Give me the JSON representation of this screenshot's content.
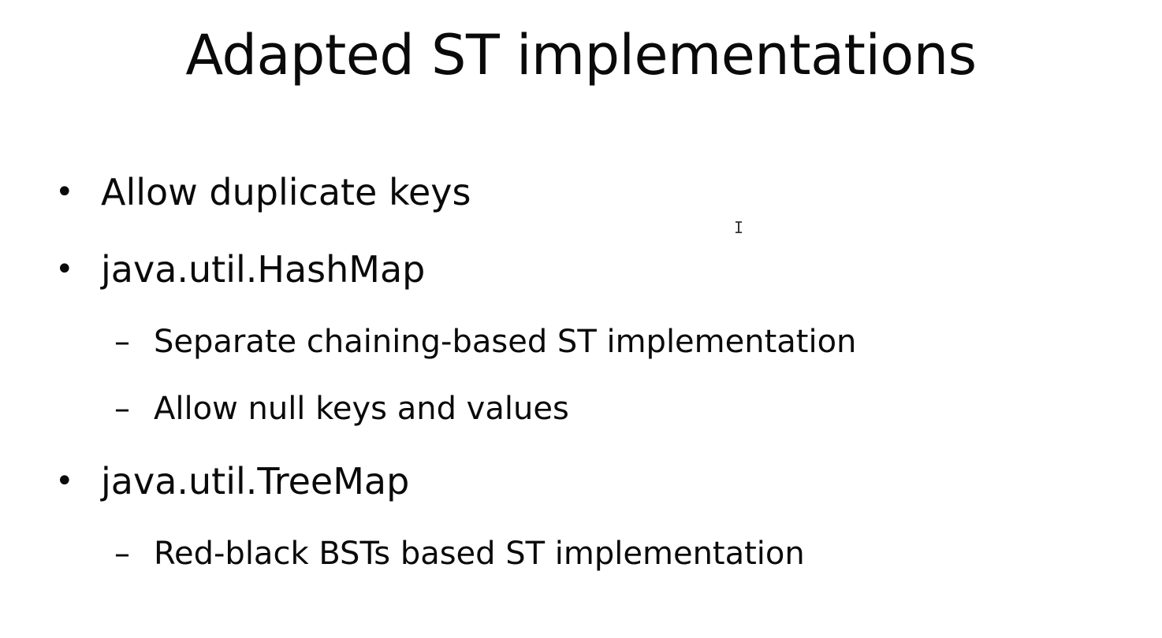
{
  "slide": {
    "title": "Adapted ST implementations",
    "bullet_symbol": "•",
    "dash_symbol": "–",
    "items": [
      {
        "text": "Allow duplicate keys"
      },
      {
        "text": "java.util.HashMap",
        "subitems": [
          {
            "text": "Separate chaining-based ST implementation"
          },
          {
            "text": "Allow null keys and values"
          }
        ]
      },
      {
        "text": "java.util.TreeMap",
        "subitems": [
          {
            "text": "Red-black BSTs based ST implementation"
          }
        ]
      }
    ]
  },
  "cursor": {
    "icon": "text-cursor-icon",
    "glyph": "I"
  }
}
